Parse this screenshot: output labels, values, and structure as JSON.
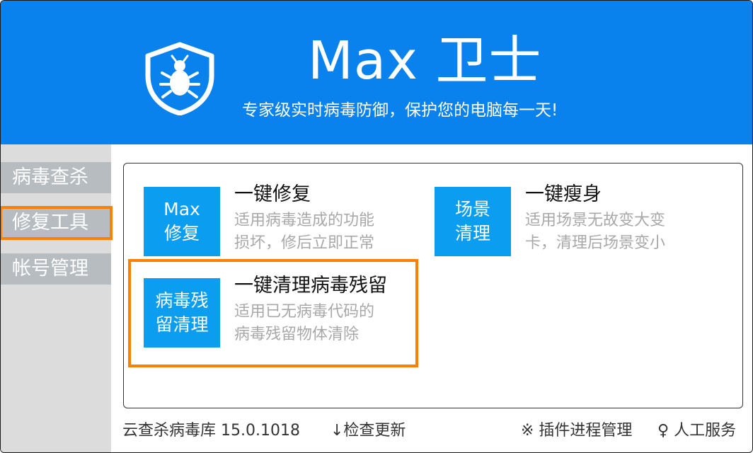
{
  "header": {
    "title": "Max 卫士",
    "subtitle": "专家级实时病毒防御，保护您的电脑每一天!",
    "logo_icon": "shield-bug-icon",
    "background": "#0a82ee"
  },
  "sidebar": {
    "items": [
      {
        "label": "病毒查杀"
      },
      {
        "label": "修复工具",
        "active": true
      },
      {
        "label": "帐号管理"
      }
    ]
  },
  "tools": {
    "repair": {
      "icon_line1": "Max",
      "icon_line2": "修复",
      "title": "一键修复",
      "desc_line1": "适用病毒造成的功能",
      "desc_line2": "损坏，修后立即正常"
    },
    "slim": {
      "icon_line1": "场景",
      "icon_line2": "清理",
      "title": "一键瘦身",
      "desc_line1": "适用场景无故变大变",
      "desc_line2": "卡，清理后场景变小"
    },
    "residue": {
      "icon_line1": "病毒残",
      "icon_line2": "留清理",
      "title": "一键清理病毒残留",
      "desc_line1": "适用已无病毒代码的",
      "desc_line2": "病毒残留物体清除",
      "highlighted": true
    }
  },
  "footer": {
    "db_version": "云查杀病毒库 15.0.1018",
    "check_update": "↓检查更新",
    "plugin_manage": "※ 插件进程管理",
    "support": "♀ 人工服务"
  },
  "colors": {
    "accent": "#0a9df0",
    "highlight": "#ff8000",
    "nav_bg": "#b6bcc0"
  }
}
